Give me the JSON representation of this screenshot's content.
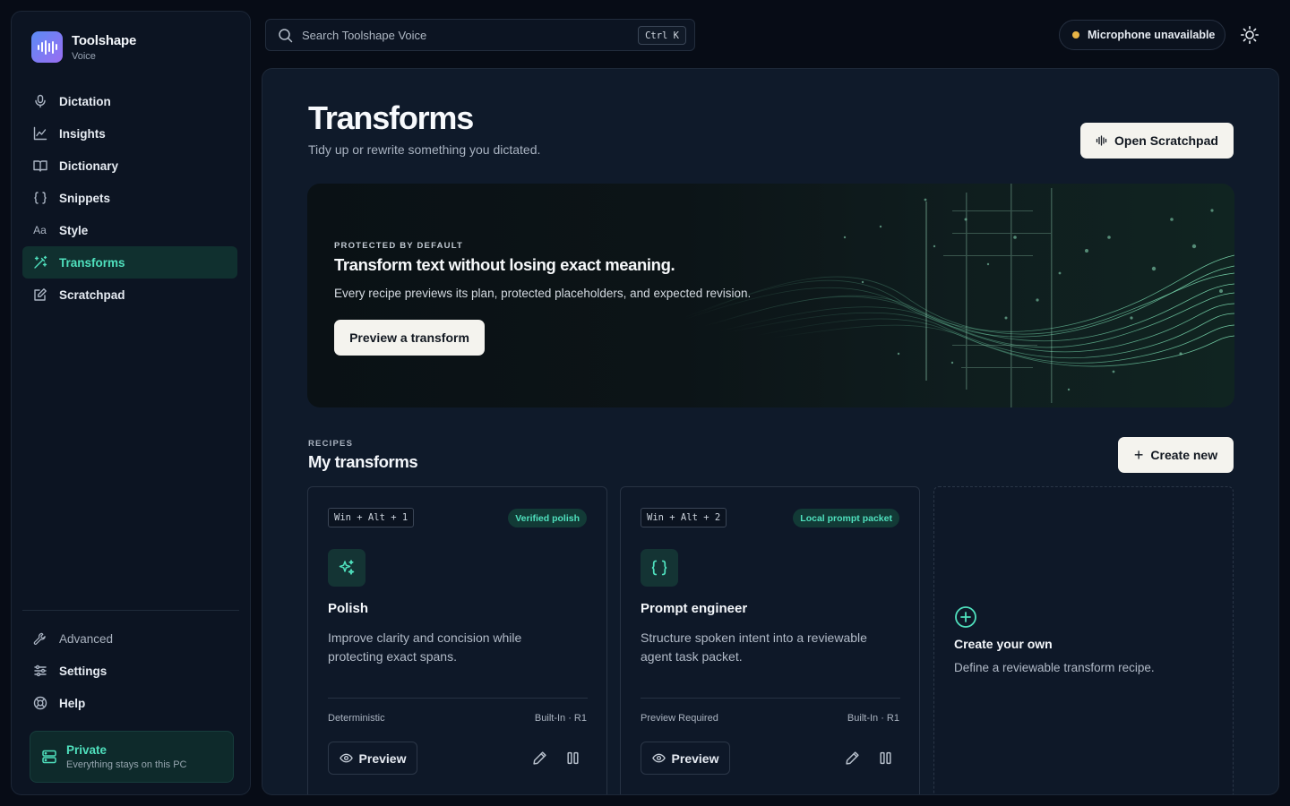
{
  "brand": {
    "name": "Toolshape",
    "subtitle": "Voice",
    "logo_icon": "waveform-icon"
  },
  "sidebar": {
    "items": [
      {
        "label": "Dictation",
        "icon": "microphone-icon",
        "active": false
      },
      {
        "label": "Insights",
        "icon": "line-chart-icon",
        "active": false
      },
      {
        "label": "Dictionary",
        "icon": "book-open-icon",
        "active": false
      },
      {
        "label": "Snippets",
        "icon": "braces-icon",
        "active": false
      },
      {
        "label": "Style",
        "icon": "text-aa-icon",
        "active": false
      },
      {
        "label": "Transforms",
        "icon": "wand-sparkle-icon",
        "active": true
      },
      {
        "label": "Scratchpad",
        "icon": "edit-square-icon",
        "active": false
      }
    ],
    "bottom": [
      {
        "label": "Advanced",
        "icon": "wrench-icon"
      },
      {
        "label": "Settings",
        "icon": "sliders-icon"
      },
      {
        "label": "Help",
        "icon": "lifebuoy-icon"
      }
    ],
    "private": {
      "title": "Private",
      "subtitle": "Everything stays on this PC",
      "icon": "server-icon"
    }
  },
  "topbar": {
    "search_placeholder": "Search Toolshape Voice",
    "search_shortcut": "Ctrl K",
    "mic_status": "Microphone unavailable",
    "mic_status_color": "#e8b446",
    "theme_icon": "sun-icon"
  },
  "page": {
    "title": "Transforms",
    "subtitle": "Tidy up or rewrite something you dictated.",
    "open_scratchpad_label": "Open Scratchpad"
  },
  "hero": {
    "eyebrow": "PROTECTED BY DEFAULT",
    "title": "Transform text without losing exact meaning.",
    "description": "Every recipe previews its plan, protected placeholders, and expected revision.",
    "button_label": "Preview a transform"
  },
  "recipes": {
    "eyebrow": "RECIPES",
    "title": "My transforms",
    "create_label": "Create new",
    "cards": [
      {
        "shortcut": "Win + Alt + 1",
        "badge": "Verified polish",
        "icon": "sparkles-icon",
        "title": "Polish",
        "description": "Improve clarity and concision while protecting exact spans.",
        "meta_left": "Deterministic",
        "meta_right": "Built-In · R1",
        "preview_label": "Preview"
      },
      {
        "shortcut": "Win + Alt + 2",
        "badge": "Local prompt packet",
        "icon": "braces-icon",
        "title": "Prompt engineer",
        "description": "Structure spoken intent into a reviewable agent task packet.",
        "meta_left": "Preview Required",
        "meta_right": "Built-In · R1",
        "preview_label": "Preview"
      }
    ],
    "create_own": {
      "title": "Create your own",
      "description": "Define a reviewable transform recipe.",
      "icon": "plus-circle-icon"
    }
  },
  "colors": {
    "accent": "#4fe0bd",
    "background": "#070c16",
    "panel": "#0f1a2a",
    "sidebar": "#0c1422"
  }
}
